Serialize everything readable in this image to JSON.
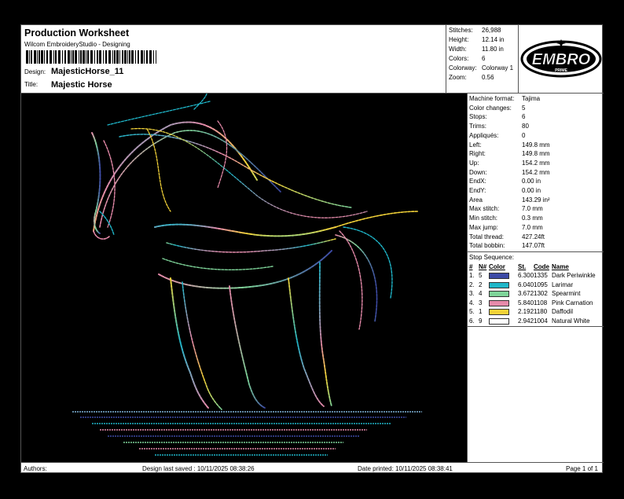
{
  "header": {
    "title": "Production Worksheet",
    "software": "Wilcom EmbroideryStudio - Designing",
    "design_label": "Design:",
    "design_value": "MajesticHorse_11",
    "title_label": "Title:",
    "title_value": "Majestic Horse"
  },
  "stats": [
    {
      "label": "Stitches:",
      "value": "26,988"
    },
    {
      "label": "Height:",
      "value": "12.14 in"
    },
    {
      "label": "Width:",
      "value": "11.80 in"
    },
    {
      "label": "Colors:",
      "value": "6"
    },
    {
      "label": "Colorway:",
      "value": "Colorway 1"
    },
    {
      "label": "Zoom:",
      "value": "0.56"
    }
  ],
  "logo": {
    "text": "EMBRO",
    "sub": "PRIME"
  },
  "properties": [
    {
      "label": "Machine format:",
      "value": "Tajima"
    },
    {
      "label": "Color changes:",
      "value": "5"
    },
    {
      "label": "Stops:",
      "value": "6"
    },
    {
      "label": "Trims:",
      "value": "80"
    },
    {
      "label": "Appliqués:",
      "value": "0"
    },
    {
      "label": "Left:",
      "value": "149.8 mm"
    },
    {
      "label": "Right:",
      "value": "149.8 mm"
    },
    {
      "label": "Up:",
      "value": "154.2 mm"
    },
    {
      "label": "Down:",
      "value": "154.2 mm"
    },
    {
      "label": "EndX:",
      "value": "0.00 in"
    },
    {
      "label": "EndY:",
      "value": "0.00 in"
    },
    {
      "label": "Area",
      "value": "143.29 in²"
    },
    {
      "label": "Max stitch:",
      "value": "7.0 mm"
    },
    {
      "label": "Min stitch:",
      "value": "0.3 mm"
    },
    {
      "label": "Max jump:",
      "value": "7.0 mm"
    },
    {
      "label": "Total thread:",
      "value": "427.24ft"
    },
    {
      "label": "Total bobbin:",
      "value": "147.07ft"
    }
  ],
  "stop_sequence": {
    "title": "Stop Sequence:",
    "headers": {
      "num": "#",
      "n": "N#",
      "color": "Color",
      "st": "St.",
      "code": "Code",
      "name": "Name"
    },
    "rows": [
      {
        "num": "1.",
        "n": "5",
        "color": "#3d4aa6",
        "st": "6.300",
        "code": "1335",
        "name": "Dark Periwinkle"
      },
      {
        "num": "2.",
        "n": "2",
        "color": "#1fb6c9",
        "st": "6.040",
        "code": "1095",
        "name": "Larimar"
      },
      {
        "num": "3.",
        "n": "4",
        "color": "#7fd59a",
        "st": "3.672",
        "code": "1302",
        "name": "Spearmint"
      },
      {
        "num": "4.",
        "n": "3",
        "color": "#e68aaa",
        "st": "5.840",
        "code": "1108",
        "name": "Pink Carnation"
      },
      {
        "num": "5.",
        "n": "1",
        "color": "#f3d338",
        "st": "2.192",
        "code": "1180",
        "name": "Daffodil"
      },
      {
        "num": "6.",
        "n": "9",
        "color": "#ffffff",
        "st": "2.942",
        "code": "1004",
        "name": "Natural White"
      }
    ]
  },
  "footer": {
    "authors": "Authors:",
    "saved": "Design last saved : 10/11/2025 08:38:26",
    "printed": "Date printed: 10/11/2025 08:38:41",
    "page": "Page 1 of 1"
  }
}
